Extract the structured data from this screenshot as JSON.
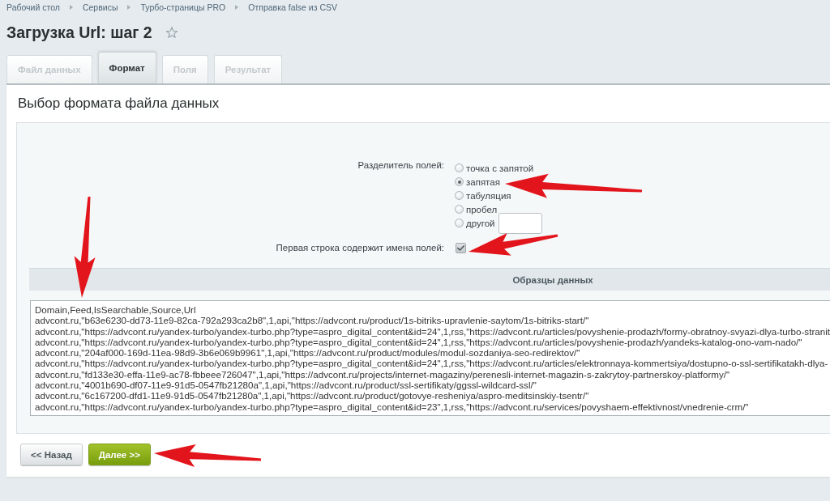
{
  "breadcrumbs": [
    {
      "label": "Рабочий стол"
    },
    {
      "label": "Сервисы"
    },
    {
      "label": "Турбо-страницы PRO"
    },
    {
      "label": "Отправка false из CSV"
    }
  ],
  "page": {
    "title": "Загрузка Url: шаг 2",
    "favorite": false
  },
  "tabs": [
    {
      "label": "Файл данных",
      "selected": false,
      "disabled": true
    },
    {
      "label": "Формат",
      "selected": true,
      "disabled": false
    },
    {
      "label": "Поля",
      "selected": false,
      "disabled": true
    },
    {
      "label": "Результат",
      "selected": false,
      "disabled": true
    }
  ],
  "panel": {
    "heading": "Выбор формата файла данных"
  },
  "delimiter": {
    "label": "Разделитель полей:",
    "options": [
      {
        "label": "точка с запятой",
        "selected": false,
        "kind": "plain"
      },
      {
        "label": "запятая",
        "selected": true,
        "kind": "plain"
      },
      {
        "label": "табуляция",
        "selected": false,
        "kind": "plain"
      },
      {
        "label": "пробел",
        "selected": false,
        "kind": "plain"
      },
      {
        "label": "другой",
        "selected": false,
        "kind": "custom"
      }
    ]
  },
  "first_row_names": {
    "label": "Первая строка содержит имена полей:",
    "checked": true
  },
  "samples": {
    "title": "Образцы данных",
    "lines": [
      "Domain,Feed,IsSearchable,Source,Url",
      "advcont.ru,\"b63e6230-dd73-11e9-82ca-792a293ca2b8\",1,api,\"https://advcont.ru/product/1s-bitriks-upravlenie-saytom/1s-bitriks-start/\"",
      "advcont.ru,\"https://advcont.ru/yandex-turbo/yandex-turbo.php?type=aspro_digital_content&id=24\",1,rss,\"https://advcont.ru/articles/povyshenie-prodazh/formy-obratnoy-svyazi-dlya-turbo-stranit",
      "advcont.ru,\"https://advcont.ru/yandex-turbo/yandex-turbo.php?type=aspro_digital_content&id=24\",1,rss,\"https://advcont.ru/articles/povyshenie-prodazh/yandeks-katalog-ono-vam-nado/\"",
      "advcont.ru,\"204af000-169d-11ea-98d9-3b6e069b9961\",1,api,\"https://advcont.ru/product/modules/modul-sozdaniya-seo-redirektov/\"",
      "advcont.ru,\"https://advcont.ru/yandex-turbo/yandex-turbo.php?type=aspro_digital_content&id=24\",1,rss,\"https://advcont.ru/articles/elektronnaya-kommertsiya/dostupno-o-ssl-sertifikatakh-dlya-",
      "advcont.ru,\"fd133e30-effa-11e9-ac78-fbbeee726047\",1,api,\"https://advcont.ru/projects/internet-magaziny/perenesli-internet-magazin-s-zakrytoy-partnerskoy-platformy/\"",
      "advcont.ru,\"4001b690-df07-11e9-91d5-0547fb21280a\",1,api,\"https://advcont.ru/product/ssl-sertifikaty/ggssl-wildcard-ssl/\"",
      "advcont.ru,\"6c167200-dfd1-11e9-91d5-0547fb21280a\",1,api,\"https://advcont.ru/product/gotovye-resheniya/aspro-meditsinskiy-tsentr/\"",
      "advcont.ru,\"https://advcont.ru/yandex-turbo/yandex-turbo.php?type=aspro_digital_content&id=23\",1,rss,\"https://advcont.ru/services/povyshaem-effektivnost/vnedrenie-crm/\""
    ]
  },
  "buttons": [
    {
      "label": "<< Назад",
      "kind": "secondary"
    },
    {
      "label": "Далее >>",
      "kind": "primary"
    }
  ]
}
